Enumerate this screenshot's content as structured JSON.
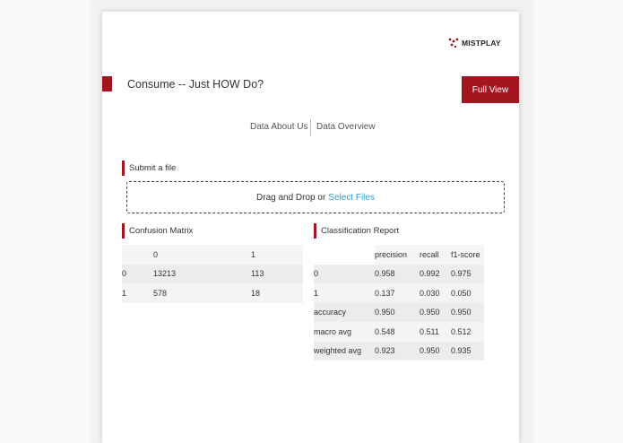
{
  "brand": {
    "logo_text": "MISTPLAY",
    "accent_color": "#a3161f",
    "link_color": "#2a9fd6"
  },
  "header": {
    "title": "Consume -- Just HOW Do?",
    "full_view_label": "Full View"
  },
  "nav": {
    "items": [
      {
        "label": "Data About Us"
      },
      {
        "label": "Data Overview"
      }
    ]
  },
  "upload": {
    "heading": "Submit a file",
    "prompt": "Drag and Drop or",
    "link_label": "Select Files"
  },
  "confusion_matrix": {
    "heading": "Confusion Matrix",
    "columns": [
      "",
      "0",
      "1"
    ],
    "rows": [
      [
        "0",
        "13213",
        "113"
      ],
      [
        "1",
        "578",
        "18"
      ]
    ]
  },
  "classification_report": {
    "heading": "Classification Report",
    "columns": [
      "",
      "precision",
      "recall",
      "f1-score"
    ],
    "rows": [
      [
        "0",
        "0.958",
        "0.992",
        "0.975"
      ],
      [
        "1",
        "0.137",
        "0.030",
        "0.050"
      ],
      [
        "accuracy",
        "0.950",
        "0.950",
        "0.950"
      ],
      [
        "macro avg",
        "0.548",
        "0.511",
        "0.512"
      ],
      [
        "weighted avg",
        "0.923",
        "0.950",
        "0.935"
      ]
    ]
  }
}
